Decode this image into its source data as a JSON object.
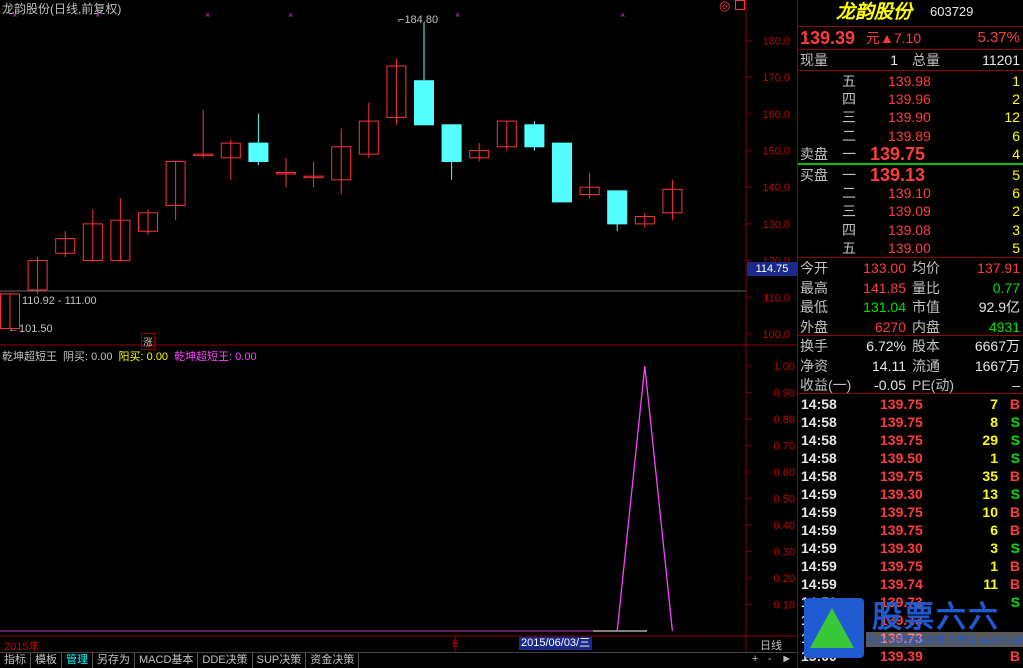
{
  "chart_title": "龙韵股份(日线,前复权)",
  "price_axis": {
    "ticks": [
      "180.0",
      "170.0",
      "160.0",
      "150.0",
      "140.0",
      "130.0",
      "120.0",
      "110.0",
      "100.0"
    ],
    "current_marker": "114.75"
  },
  "annotations": {
    "high": "184.80",
    "range_label": "110.92 - 111.00",
    "low": "101.50",
    "zhang": "涨"
  },
  "indicator_legend": [
    {
      "label": "乾坤超短王",
      "color": "#c0c0c0"
    },
    {
      "label": "阴买: 0.00",
      "color": "#c0c0c0"
    },
    {
      "label": "阳买: 0.00",
      "color": "#ffff00"
    },
    {
      "label": "乾坤超短王: 0.00",
      "color": "#ff40ff"
    }
  ],
  "indicator_axis": {
    "ticks": [
      "1.00",
      "0.90",
      "0.80",
      "0.70",
      "0.60",
      "0.50",
      "0.40",
      "0.30",
      "0.20",
      "0.10"
    ]
  },
  "time_axis": {
    "year_label": "2015年",
    "month_label": "6",
    "cursor_date": "2015/06/03/三",
    "period": "日线"
  },
  "chart_data": {
    "type": "candlestick",
    "candles": [
      {
        "o": 101.5,
        "c": 110.9,
        "h": 111.0,
        "l": 101.5
      },
      {
        "o": 112.0,
        "c": 120.0,
        "h": 121.0,
        "l": 111.0
      },
      {
        "o": 122.0,
        "c": 126.0,
        "h": 128.0,
        "l": 121.0
      },
      {
        "o": 120.0,
        "c": 130.0,
        "h": 134.0,
        "l": 120.0
      },
      {
        "o": 120.0,
        "c": 131.0,
        "h": 137.0,
        "l": 120.0
      },
      {
        "o": 128.0,
        "c": 133.0,
        "h": 134.0,
        "l": 127.0
      },
      {
        "o": 135.0,
        "c": 147.0,
        "h": 147.0,
        "l": 131.0
      },
      {
        "o": 149.0,
        "c": 149.0,
        "h": 161.0,
        "l": 148.0
      },
      {
        "o": 148.0,
        "c": 152.0,
        "h": 153.0,
        "l": 142.0
      },
      {
        "o": 152.0,
        "c": 147.0,
        "h": 160.0,
        "l": 146.0
      },
      {
        "o": 144.0,
        "c": 144.0,
        "h": 148.0,
        "l": 140.0
      },
      {
        "o": 143.0,
        "c": 143.0,
        "h": 147.0,
        "l": 140.0
      },
      {
        "o": 142.0,
        "c": 151.0,
        "h": 156.0,
        "l": 138.0
      },
      {
        "o": 149.0,
        "c": 158.0,
        "h": 163.0,
        "l": 148.0
      },
      {
        "o": 159.0,
        "c": 173.0,
        "h": 175.0,
        "l": 157.0
      },
      {
        "o": 169.0,
        "c": 157.0,
        "h": 184.8,
        "l": 157.0
      },
      {
        "o": 157.0,
        "c": 147.0,
        "h": 157.0,
        "l": 142.0
      },
      {
        "o": 148.0,
        "c": 150.0,
        "h": 152.0,
        "l": 147.0
      },
      {
        "o": 151.0,
        "c": 158.0,
        "h": 158.0,
        "l": 150.0
      },
      {
        "o": 157.0,
        "c": 151.0,
        "h": 158.0,
        "l": 150.0
      },
      {
        "o": 152.0,
        "c": 136.0,
        "h": 152.0,
        "l": 136.0
      },
      {
        "o": 138.0,
        "c": 140.0,
        "h": 144.0,
        "l": 137.0
      },
      {
        "o": 139.0,
        "c": 130.0,
        "h": 139.0,
        "l": 128.0
      },
      {
        "o": 130.0,
        "c": 132.0,
        "h": 133.0,
        "l": 129.0
      },
      {
        "o": 133.0,
        "c": 139.4,
        "h": 142.0,
        "l": 131.0
      }
    ],
    "y_range": [
      97.0,
      188.0
    ],
    "indicator": {
      "x_index": [
        22,
        23,
        24
      ],
      "values": [
        0,
        1,
        0
      ]
    },
    "up_color": "#ff3232",
    "down_color": "#54ffff"
  },
  "stock": {
    "name": "龙韵股份",
    "code": "603729",
    "price": "139.39",
    "change_prefix": "元▲",
    "change": "7.10",
    "change_pct": "5.37%"
  },
  "summary": {
    "now_label": "现量",
    "now_val": "1",
    "total_label": "总量",
    "total_val": "11201"
  },
  "asks": [
    {
      "label": "五",
      "price": "139.98",
      "vol": "1"
    },
    {
      "label": "四",
      "price": "139.96",
      "vol": "2"
    },
    {
      "label": "三",
      "price": "139.90",
      "vol": "12"
    },
    {
      "label": "二",
      "price": "139.89",
      "vol": "6"
    },
    {
      "label": "一",
      "price": "139.75",
      "vol": "4"
    }
  ],
  "ask_title": "卖盘",
  "bid_title": "买盘",
  "bids": [
    {
      "label": "一",
      "price": "139.13",
      "vol": "5"
    },
    {
      "label": "二",
      "price": "139.10",
      "vol": "6"
    },
    {
      "label": "三",
      "price": "139.09",
      "vol": "2"
    },
    {
      "label": "四",
      "price": "139.08",
      "vol": "3"
    },
    {
      "label": "五",
      "price": "139.00",
      "vol": "5"
    }
  ],
  "stats": [
    {
      "l1": "今开",
      "v1": "133.00",
      "c1": "red",
      "l2": "均价",
      "v2": "137.91",
      "c2": "red"
    },
    {
      "l1": "最高",
      "v1": "141.85",
      "c1": "red",
      "l2": "量比",
      "v2": "0.77",
      "c2": "grn"
    },
    {
      "l1": "最低",
      "v1": "131.04",
      "c1": "grn",
      "l2": "市值",
      "v2": "92.9亿",
      "c2": "wht"
    },
    {
      "l1": "外盘",
      "v1": "6270",
      "c1": "red",
      "l2": "内盘",
      "v2": "4931",
      "c2": "grn"
    }
  ],
  "fund": [
    {
      "l1": "换手",
      "v1": "6.72%",
      "l2": "股本",
      "v2": "6667万"
    },
    {
      "l1": "净资",
      "v1": "14.11",
      "l2": "流通",
      "v2": "1667万"
    },
    {
      "l1": "收益(一)",
      "v1": "-0.05",
      "l2": "PE(动)",
      "v2": "–"
    }
  ],
  "ticks": [
    {
      "t": "14:58",
      "p": "139.75",
      "v": "7",
      "s": "B"
    },
    {
      "t": "14:58",
      "p": "139.75",
      "v": "8",
      "s": "S"
    },
    {
      "t": "14:58",
      "p": "139.75",
      "v": "29",
      "s": "S"
    },
    {
      "t": "14:58",
      "p": "139.50",
      "v": "1",
      "s": "S"
    },
    {
      "t": "14:58",
      "p": "139.75",
      "v": "35",
      "s": "B"
    },
    {
      "t": "14:59",
      "p": "139.30",
      "v": "13",
      "s": "S"
    },
    {
      "t": "14:59",
      "p": "139.75",
      "v": "10",
      "s": "B"
    },
    {
      "t": "14:59",
      "p": "139.75",
      "v": "6",
      "s": "B"
    },
    {
      "t": "14:59",
      "p": "139.30",
      "v": "3",
      "s": "S"
    },
    {
      "t": "14:59",
      "p": "139.75",
      "v": "1",
      "s": "B"
    },
    {
      "t": "14:59",
      "p": "139.74",
      "v": "11",
      "s": "B"
    },
    {
      "t": "14:59",
      "p": "139.73",
      "v": "",
      "s": "S"
    },
    {
      "t": "14:59",
      "p": "139.73",
      "v": "",
      "s": ""
    },
    {
      "t": "14:59",
      "p": "139.73",
      "v": "",
      "s": ""
    },
    {
      "t": "15:00",
      "p": "139.39",
      "v": "",
      "s": "B"
    }
  ],
  "watermark": {
    "title": "股票六六",
    "url": "专业股票指标软件下载站 WWW.GP66.CN"
  },
  "tabs": [
    "指标",
    "模板",
    "管理",
    "另存为",
    "MACD基本",
    "DDE决策",
    "SUP决策",
    "资金决策"
  ],
  "nav": {
    "plus": "+",
    "minus": "-",
    "right": "►"
  }
}
